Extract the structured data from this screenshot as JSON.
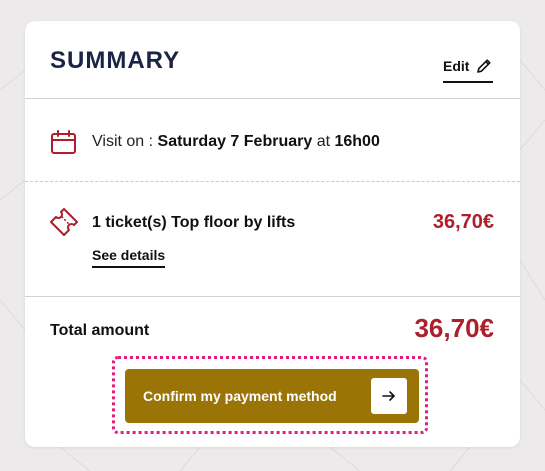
{
  "summary": {
    "title": "SUMMARY",
    "edit_label": "Edit",
    "visit": {
      "prefix": "Visit on : ",
      "date": "Saturday 7 February",
      "connector": " at ",
      "time": "16h00"
    },
    "ticket": {
      "label": "1 ticket(s) Top floor by lifts",
      "price": "36,70€",
      "details_link": "See details"
    },
    "total": {
      "label": "Total amount",
      "price": "36,70€"
    },
    "confirm_button": "Confirm my payment method"
  },
  "icons": [
    "pencil-icon",
    "calendar-icon",
    "ticket-icon",
    "arrow-right-icon"
  ],
  "colors": {
    "title": "#1c2446",
    "price": "#ad1f2d",
    "button": "#9b7408",
    "focus_ring": "#e01f7a",
    "background": "#eceaea"
  }
}
